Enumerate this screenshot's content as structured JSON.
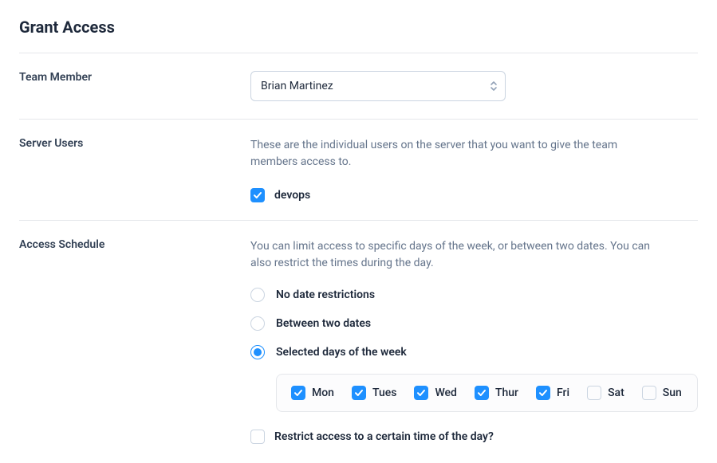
{
  "title": "Grant Access",
  "team_member": {
    "label": "Team Member",
    "selected": "Brian Martinez"
  },
  "server_users": {
    "label": "Server Users",
    "description": "These are the individual users on the server that you want to give the team members access to.",
    "users": [
      {
        "name": "devops",
        "checked": true
      }
    ]
  },
  "access_schedule": {
    "label": "Access Schedule",
    "description": "You can limit access to specific days of the week, or between two dates. You can also restrict the times during the day.",
    "options": [
      {
        "label": "No date restrictions",
        "selected": false
      },
      {
        "label": "Between two dates",
        "selected": false
      },
      {
        "label": "Selected days of the week",
        "selected": true
      }
    ],
    "days": [
      {
        "abbr": "Mon",
        "checked": true
      },
      {
        "abbr": "Tues",
        "checked": true
      },
      {
        "abbr": "Wed",
        "checked": true
      },
      {
        "abbr": "Thur",
        "checked": true
      },
      {
        "abbr": "Fri",
        "checked": true
      },
      {
        "abbr": "Sat",
        "checked": false
      },
      {
        "abbr": "Sun",
        "checked": false
      }
    ],
    "restrict_time": {
      "label": "Restrict access to a certain time of the day?",
      "checked": false
    }
  }
}
